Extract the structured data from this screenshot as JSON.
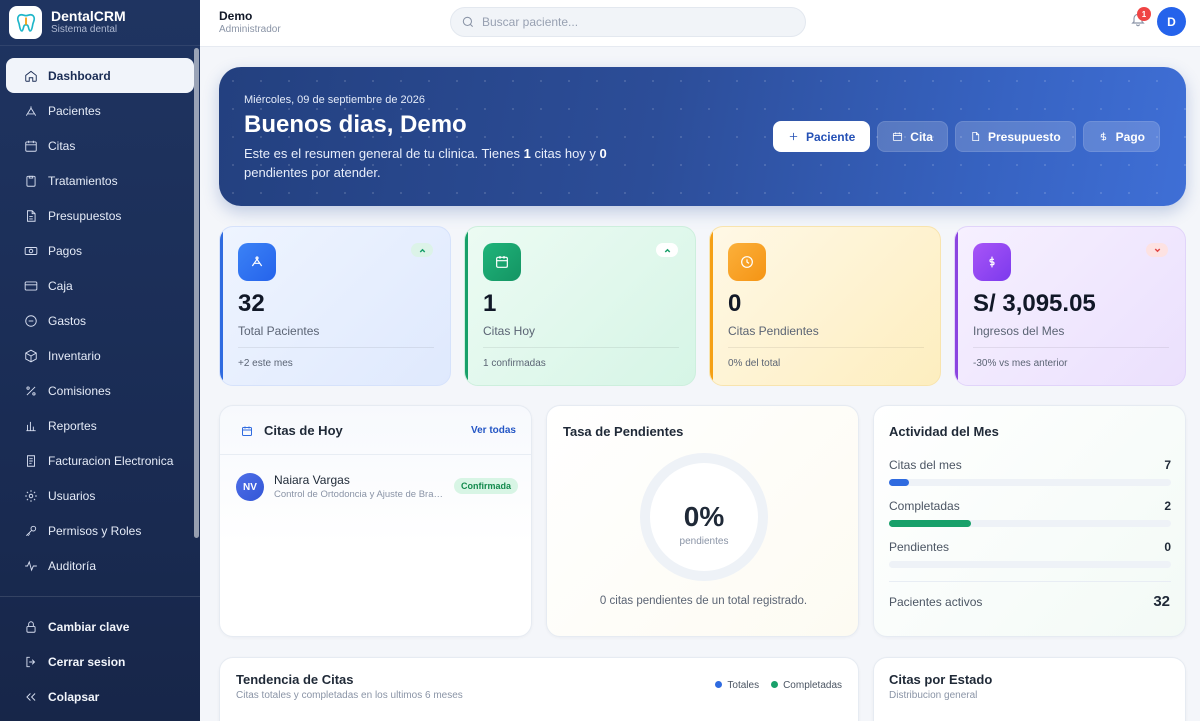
{
  "brand": {
    "name": "DentalCRM",
    "subtitle": "Sistema dental"
  },
  "sidebar": {
    "items": [
      {
        "label": "Dashboard",
        "icon": "home-icon",
        "active": true
      },
      {
        "label": "Pacientes",
        "icon": "user-icon"
      },
      {
        "label": "Citas",
        "icon": "calendar-icon"
      },
      {
        "label": "Tratamientos",
        "icon": "clipboard-icon"
      },
      {
        "label": "Presupuestos",
        "icon": "file-icon"
      },
      {
        "label": "Pagos",
        "icon": "banknote-icon"
      },
      {
        "label": "Caja",
        "icon": "credit-card-icon"
      },
      {
        "label": "Gastos",
        "icon": "minus-circle-icon"
      },
      {
        "label": "Inventario",
        "icon": "box-icon"
      },
      {
        "label": "Comisiones",
        "icon": "percent-icon"
      },
      {
        "label": "Reportes",
        "icon": "bar-chart-icon"
      },
      {
        "label": "Facturacion Electronica",
        "icon": "receipt-icon"
      },
      {
        "label": "Usuarios",
        "icon": "gear-icon"
      },
      {
        "label": "Permisos y Roles",
        "icon": "key-icon"
      },
      {
        "label": "Auditoría",
        "icon": "activity-icon"
      }
    ],
    "bottom": [
      {
        "label": "Cambiar clave",
        "icon": "lock-icon"
      },
      {
        "label": "Cerrar sesion",
        "icon": "logout-icon"
      },
      {
        "label": "Colapsar",
        "icon": "chevrons-left-icon"
      }
    ]
  },
  "topbar": {
    "user_name": "Demo",
    "user_role": "Administrador",
    "search_placeholder": "Buscar paciente...",
    "notifications": "1",
    "avatar_initial": "D"
  },
  "hero": {
    "date": "Miércoles, 09 de septiembre de 2026",
    "greeting": "Buenos dias, Demo",
    "text_1": "Este es el resumen general de tu clinica. Tienes ",
    "citas_hoy": "1",
    "text_2": " citas hoy y ",
    "pendientes": "0",
    "text_3": " pendientes por atender.",
    "actions": [
      {
        "label": "Paciente",
        "icon": "plus-icon"
      },
      {
        "label": "Cita",
        "icon": "calendar-icon"
      },
      {
        "label": "Presupuesto",
        "icon": "file-icon"
      },
      {
        "label": "Pago",
        "icon": "dollar-icon"
      }
    ]
  },
  "stats": [
    {
      "value": "32",
      "label": "Total Pacientes",
      "foot": "+2 este mes",
      "trend": "up",
      "accent": "#2f6be0"
    },
    {
      "value": "1",
      "label": "Citas Hoy",
      "foot": "1 confirmadas",
      "trend": "up",
      "accent": "#18a06a"
    },
    {
      "value": "0",
      "label": "Citas Pendientes",
      "foot": "0% del total",
      "trend": "none",
      "accent": "#f5a015"
    },
    {
      "value": "S/ 3,095.05",
      "label": "Ingresos del Mes",
      "foot": "-30% vs mes anterior",
      "trend": "down",
      "accent": "#8b45e0"
    }
  ],
  "citas_hoy": {
    "title": "Citas de Hoy",
    "link": "Ver todas",
    "items": [
      {
        "initials": "NV",
        "name": "Naiara Vargas",
        "desc": "Control de Ortodoncia y Ajuste de Brackets",
        "status": "Confirmada"
      }
    ]
  },
  "tasa": {
    "title": "Tasa de Pendientes",
    "value": "0%",
    "sub": "pendientes",
    "caption": "0 citas pendientes de un total registrado."
  },
  "actividad": {
    "title": "Actividad del Mes",
    "rows": [
      {
        "label": "Citas del mes",
        "value": "7",
        "fill": 0.07,
        "color": "#2f6be0"
      },
      {
        "label": "Completadas",
        "value": "2",
        "fill": 0.29,
        "color": "#18a06a"
      },
      {
        "label": "Pendientes",
        "value": "0",
        "fill": 0,
        "color": "#f5a015"
      }
    ],
    "pacientes_label": "Pacientes activos",
    "pacientes_value": "32"
  },
  "tendencia": {
    "title": "Tendencia de Citas",
    "subtitle": "Citas totales y completadas en los ultimos 6 meses",
    "legend": [
      {
        "label": "Totales",
        "color": "#2f6be0"
      },
      {
        "label": "Completadas",
        "color": "#18a06a"
      }
    ]
  },
  "estado": {
    "title": "Citas por Estado",
    "subtitle": "Distribucion general"
  }
}
